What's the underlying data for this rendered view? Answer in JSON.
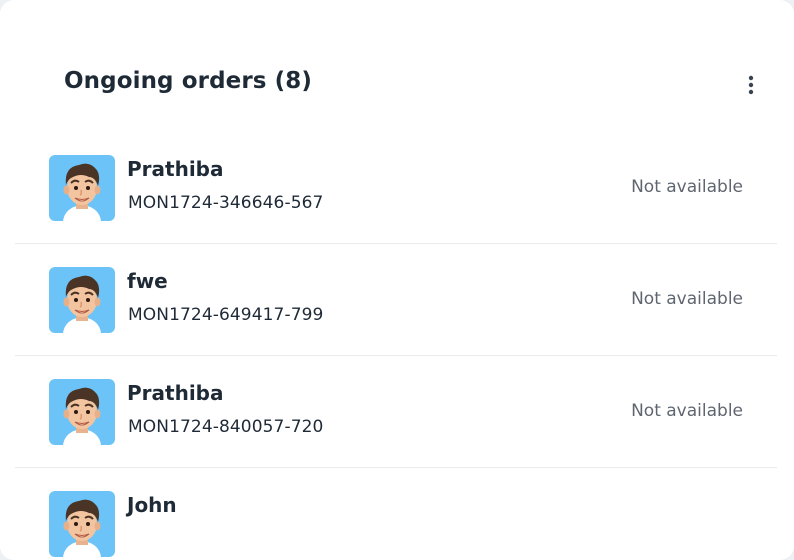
{
  "panel": {
    "title": "Ongoing orders (8)",
    "more_icon": "more-vertical-icon"
  },
  "orders": [
    {
      "name": "Prathiba",
      "order_id": "MON1724-346646-567",
      "status": "Not available",
      "avatar_icon": "memoji-avatar-icon"
    },
    {
      "name": "fwe",
      "order_id": "MON1724-649417-799",
      "status": "Not available",
      "avatar_icon": "memoji-avatar-icon"
    },
    {
      "name": "Prathiba",
      "order_id": "MON1724-840057-720",
      "status": "Not available",
      "avatar_icon": "memoji-avatar-icon"
    },
    {
      "name": "John",
      "order_id": "",
      "status": "",
      "avatar_icon": "memoji-avatar-icon"
    }
  ],
  "colors": {
    "avatar_bg": "#6cc3f7",
    "text_primary": "#1f2a37",
    "text_muted": "#5f6670",
    "divider": "#e9ecef"
  }
}
